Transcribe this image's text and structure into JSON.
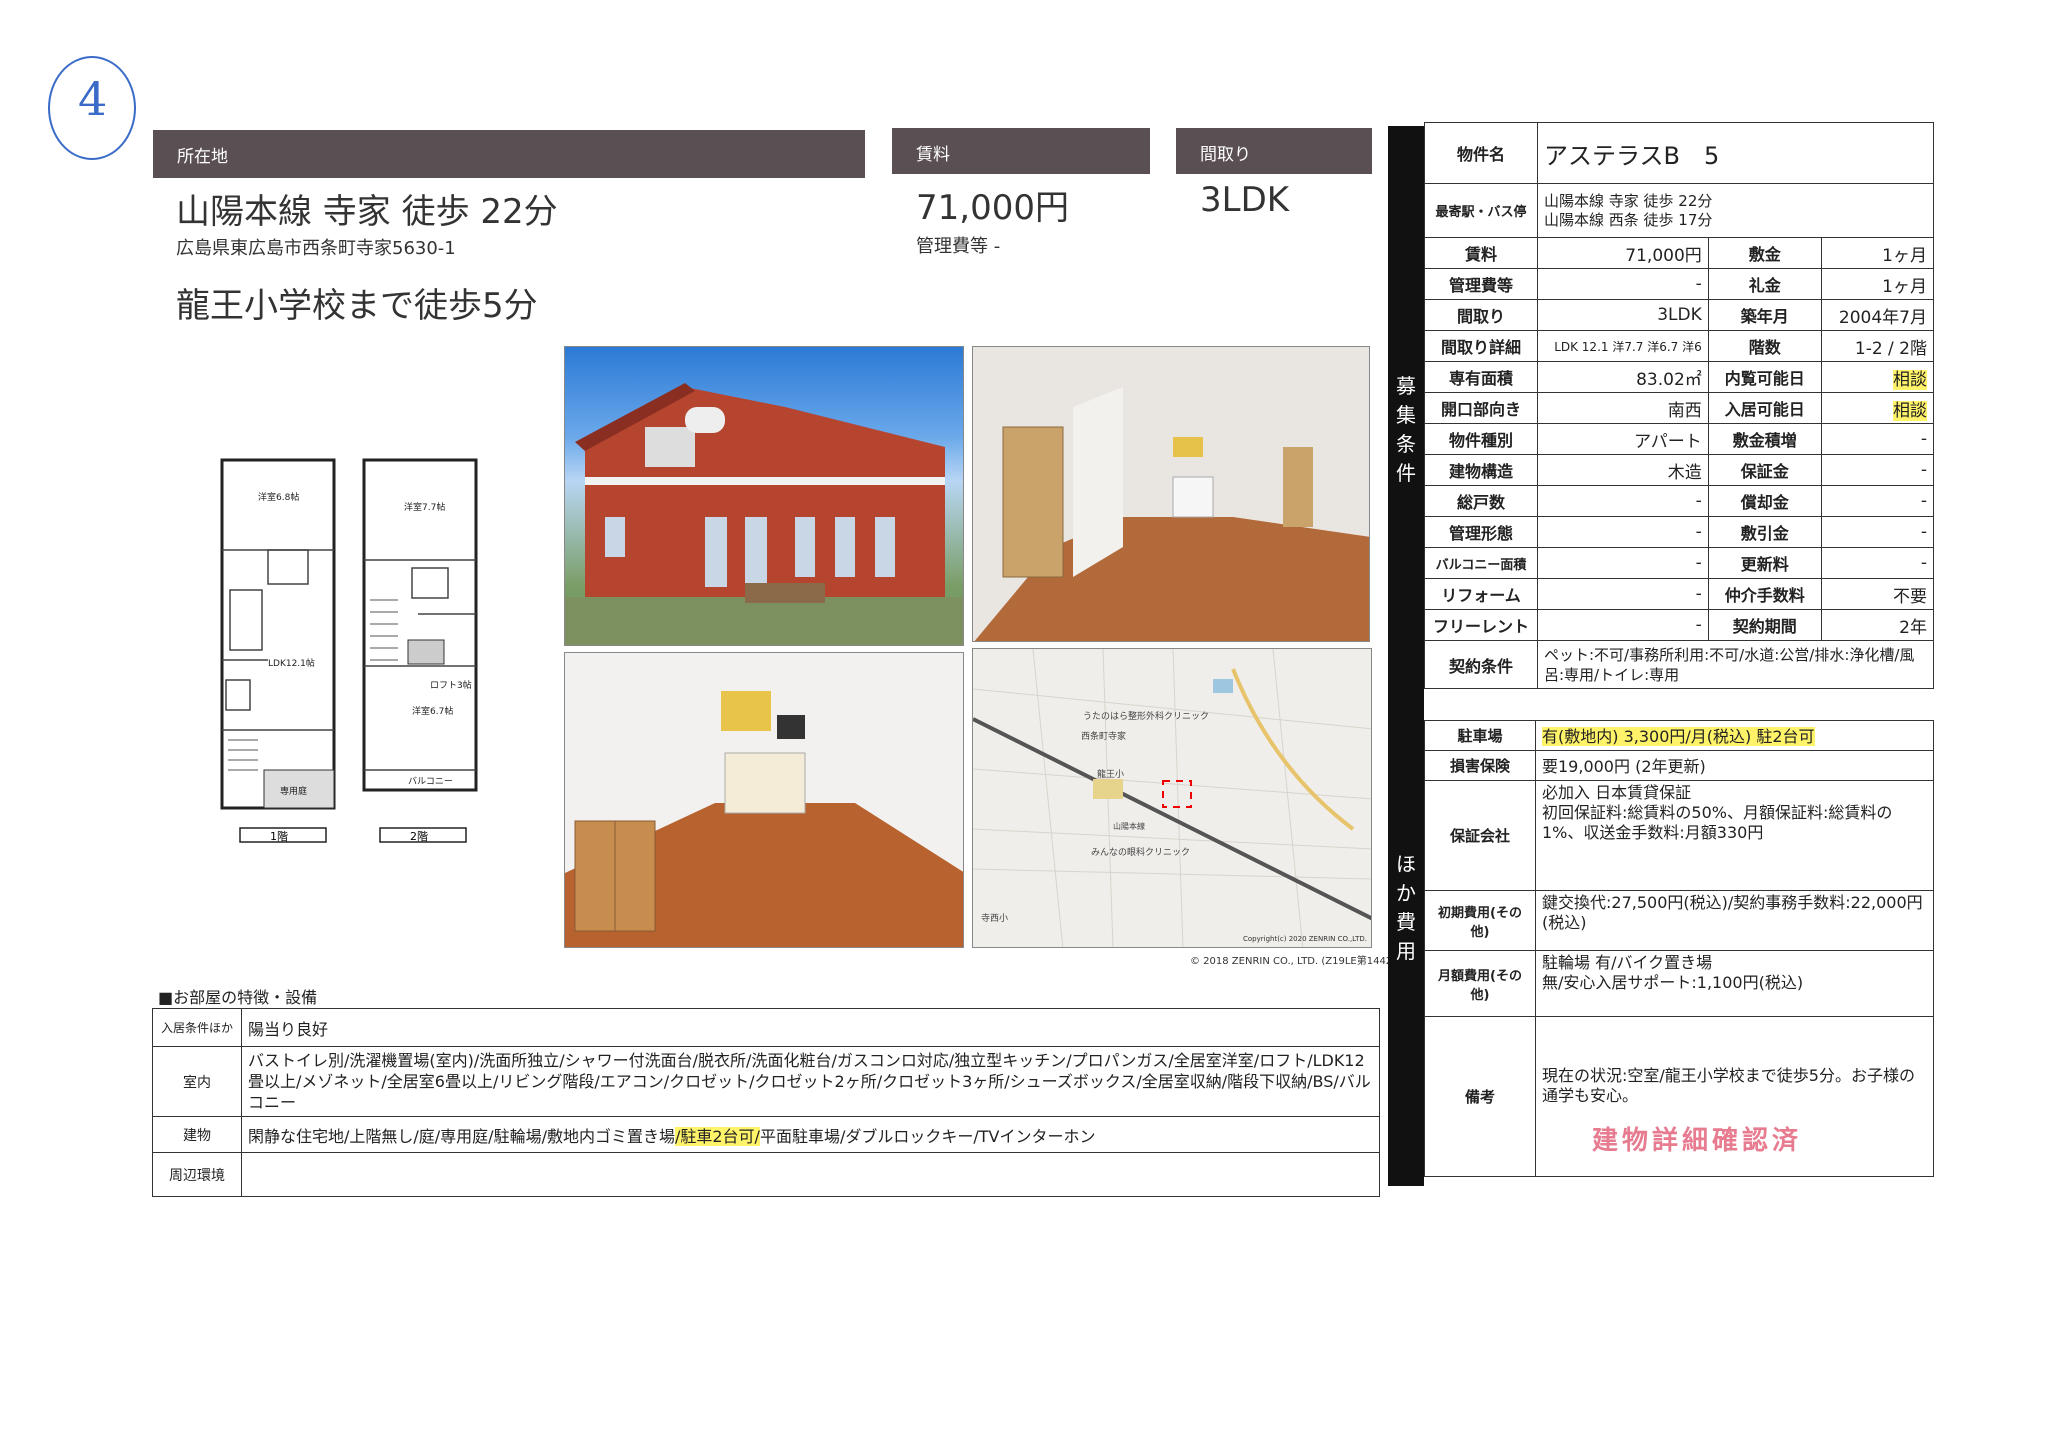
{
  "handwritten_number": "4",
  "location": {
    "header": "所在地",
    "station": "山陽本線 寺家 徒歩 22分",
    "address": "広島県東広島市西条町寺家5630-1",
    "school": "龍王小学校まで徒歩5分"
  },
  "rent_box": {
    "header": "賃料",
    "value": "71,000円",
    "fee": "管理費等 -"
  },
  "layout_box": {
    "header": "間取り",
    "value": "3LDK"
  },
  "floorplan": {
    "floor1": "1階",
    "floor2": "2階",
    "rooms": [
      "洋室6.8帖",
      "LDK12.1帖",
      "洋室7.7帖",
      "ロフト3帖",
      "洋室6.7帖",
      "バルコニー",
      "専用庭"
    ]
  },
  "map": {
    "labels": [
      "うたのはら整形外科クリニック",
      "西条町寺家",
      "龍王小",
      "みんなの眼科クリニック",
      "寺西小",
      "山陽本線"
    ],
    "copyright1": "Copyright(c) 2020 ZENRIN CO.,LTD.",
    "copyright2": "© 2018 ZENRIN CO., LTD. (Z19LE第1442号)"
  },
  "property": {
    "name_label": "物件名",
    "name": "アステラスB　5",
    "station_label": "最寄駅・バス停",
    "station1": "山陽本線 寺家 徒歩 22分",
    "station2": "山陽本線 西条 徒歩 17分"
  },
  "sidebar1": "募集条件",
  "sidebar2": "ほか費用",
  "conditions": [
    {
      "l1": "賃料",
      "v1": "71,000円",
      "l2": "敷金",
      "v2": "1ヶ月",
      "hl": false
    },
    {
      "l1": "管理費等",
      "v1": "-",
      "l2": "礼金",
      "v2": "1ヶ月",
      "hl": false
    },
    {
      "l1": "間取り",
      "v1": "3LDK",
      "l2": "築年月",
      "v2": "2004年7月",
      "hl": false
    },
    {
      "l1": "間取り詳細",
      "v1": "LDK 12.1 洋7.7 洋6.7 洋6",
      "l2": "階数",
      "v2": "1-2 / 2階",
      "hl": false
    },
    {
      "l1": "専有面積",
      "v1": "83.02㎡",
      "l2": "内覧可能日",
      "v2": "相談",
      "hl": true
    },
    {
      "l1": "開口部向き",
      "v1": "南西",
      "l2": "入居可能日",
      "v2": "相談",
      "hl": true
    },
    {
      "l1": "物件種別",
      "v1": "アパート",
      "l2": "敷金積増",
      "v2": "-",
      "hl": false
    },
    {
      "l1": "建物構造",
      "v1": "木造",
      "l2": "保証金",
      "v2": "-",
      "hl": false
    },
    {
      "l1": "総戸数",
      "v1": "-",
      "l2": "償却金",
      "v2": "-",
      "hl": false
    },
    {
      "l1": "管理形態",
      "v1": "-",
      "l2": "敷引金",
      "v2": "-",
      "hl": false
    },
    {
      "l1": "バルコニー面積",
      "v1": "-",
      "l2": "更新料",
      "v2": "-",
      "hl": false
    },
    {
      "l1": "リフォーム",
      "v1": "-",
      "l2": "仲介手数料",
      "v2": "不要",
      "hl": false
    },
    {
      "l1": "フリーレント",
      "v1": "-",
      "l2": "契約期間",
      "v2": "2年",
      "hl": false
    }
  ],
  "contract": {
    "label": "契約条件",
    "value": "ペット:不可/事務所利用:不可/水道:公営/排水:浄化槽/風呂:専用/トイレ:専用"
  },
  "costs": {
    "parking_label": "駐車場",
    "parking": "有(敷地内) 3,300円/月(税込) 駐2台可",
    "insurance_label": "損害保険",
    "insurance": "要19,000円 (2年更新)",
    "guarantee_label": "保証会社",
    "guarantee": "必加入 日本賃貸保証\n初回保証料:総賃料の50%、月額保証料:総賃料の1%、収送金手数料:月額330円",
    "initial_label": "初期費用(その他)",
    "initial": "鍵交換代:27,500円(税込)/契約事務手数料:22,000円(税込)",
    "monthly_label": "月額費用(その他)",
    "monthly": "駐輪場 有/バイク置き場\n無/安心入居サポート:1,100円(税込)",
    "notes_label": "備考",
    "notes": "現在の状況:空室/龍王小学校まで徒歩5分。お子様の通学も安心。",
    "stamp": "建物詳細確認済"
  },
  "features": {
    "title": "■お部屋の特徴・設備",
    "rows": [
      {
        "label": "入居条件ほか",
        "value": "陽当り良好"
      },
      {
        "label": "室内",
        "value": "バストイレ別/洗濯機置場(室内)/洗面所独立/シャワー付洗面台/脱衣所/洗面化粧台/ガスコンロ対応/独立型キッチン/プロパンガス/全居室洋室/ロフト/LDK12畳以上/メゾネット/全居室6畳以上/リビング階段/エアコン/クロゼット/クロゼット2ヶ所/クロゼット3ヶ所/シューズボックス/全居室収納/階段下収納/BS/バルコニー"
      },
      {
        "label": "建物",
        "value_a": "閑静な住宅地/上階無し/庭/専用庭/駐輪場/敷地内ゴミ置き場",
        "value_hl": "/駐車2台可/",
        "value_b": "平面駐車場/ダブルロックキー/TVインターホン"
      },
      {
        "label": "周辺環境",
        "value": ""
      }
    ]
  }
}
